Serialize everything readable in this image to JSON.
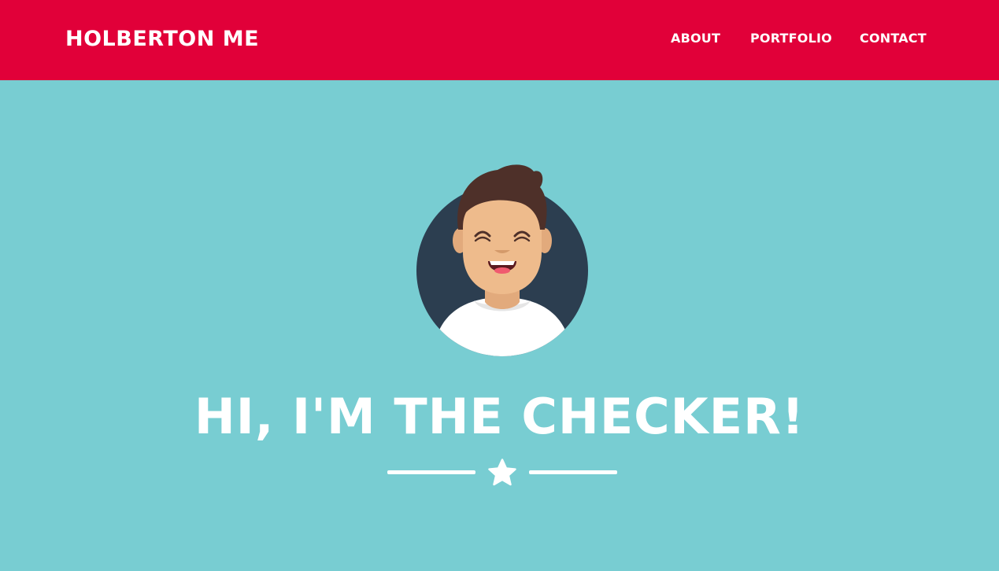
{
  "navbar": {
    "brand": "HOLBERTON ME",
    "links": [
      {
        "label": "ABOUT"
      },
      {
        "label": "PORTFOLIO"
      },
      {
        "label": "CONTACT"
      }
    ]
  },
  "hero": {
    "title": "HI, I'M THE CHECKER!",
    "avatar_icon": "smiling-person-avatar-icon",
    "divider_icon": "star-icon"
  },
  "colors": {
    "navbar_bg": "#e10039",
    "page_bg": "#78cdd2",
    "text": "#ffffff",
    "avatar_circle": "#2c3e50",
    "skin": "#eebb8c",
    "hair": "#4e3029"
  }
}
